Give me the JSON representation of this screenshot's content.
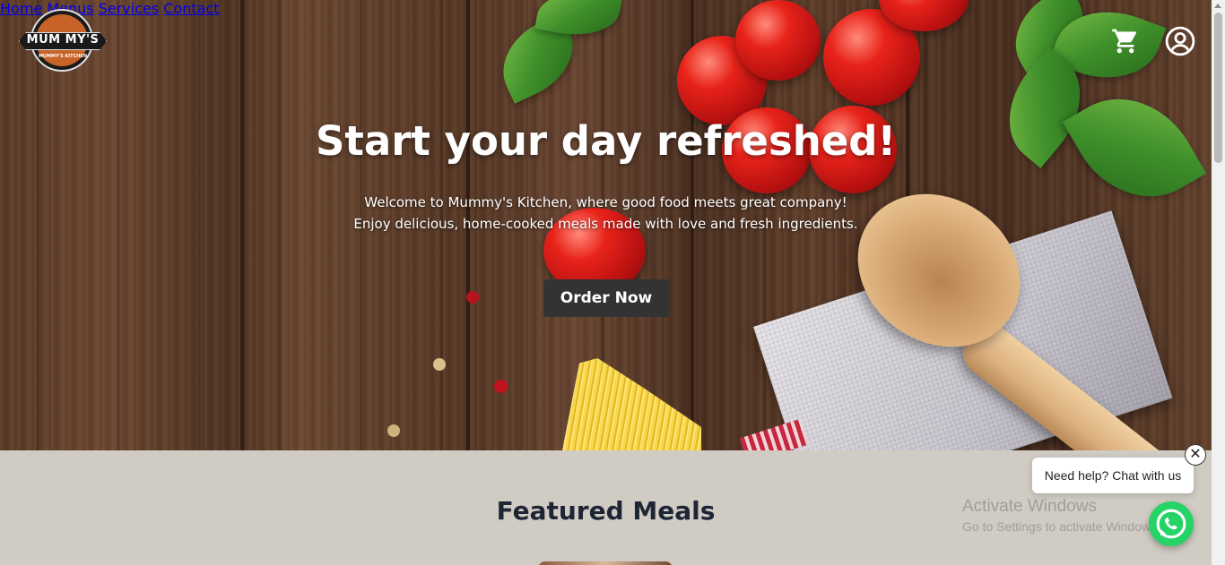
{
  "brand": {
    "logo_text": "MUM MY'S",
    "logo_sub": "MUMMY'S KITCHEN"
  },
  "nav": {
    "items": [
      {
        "label": "Home"
      },
      {
        "label": "Menus"
      },
      {
        "label": "Services"
      },
      {
        "label": "Contact"
      }
    ],
    "cart_icon": "cart-icon",
    "account_icon": "user-account-icon"
  },
  "hero": {
    "title": "Start your day refreshed!",
    "line1": "Welcome to Mummy's Kitchen, where good food meets great company!",
    "line2": "Enjoy delicious, home-cooked meals made with love and fresh ingredients.",
    "cta_label": "Order Now"
  },
  "featured": {
    "title": "Featured Meals"
  },
  "chat_widget": {
    "bubble_text": "Need help? Chat with us",
    "close_symbol": "✕",
    "icon": "whatsapp-icon",
    "accent": "#25d366"
  },
  "watermark": {
    "title": "Activate Windows",
    "subtitle": "Go to Settings to activate Windows."
  },
  "colors": {
    "cta_bg": "#333333",
    "section_bg": "#d0ccc4",
    "heading": "#1e2535"
  }
}
